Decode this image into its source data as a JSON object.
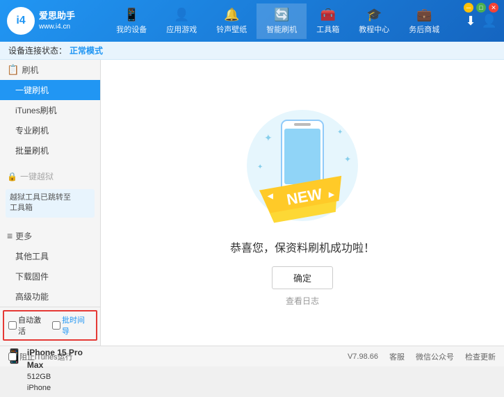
{
  "app": {
    "logo_line1": "爱思助手",
    "logo_line2": "www.i4.cn",
    "logo_letter": "i4"
  },
  "nav": {
    "items": [
      {
        "id": "my-device",
        "icon": "📱",
        "label": "我的设备"
      },
      {
        "id": "app-games",
        "icon": "👤",
        "label": "应用游戏"
      },
      {
        "id": "ringtones",
        "icon": "🔔",
        "label": "铃声壁纸"
      },
      {
        "id": "smart-flash",
        "icon": "🔄",
        "label": "智能刷机",
        "active": true
      },
      {
        "id": "toolbox",
        "icon": "🧰",
        "label": "工具箱"
      },
      {
        "id": "tutorial",
        "icon": "🎓",
        "label": "教程中心"
      },
      {
        "id": "service",
        "icon": "💼",
        "label": "务后商城"
      }
    ],
    "right_download": "⬇",
    "right_user": "👤"
  },
  "status_bar": {
    "prefix": "设备连接状态：",
    "status": "正常模式"
  },
  "sidebar": {
    "flash_section": "刷机",
    "items": [
      {
        "id": "one-key-flash",
        "label": "一键刷机",
        "active": true
      },
      {
        "id": "itunes-flash",
        "label": "iTunes刷机"
      },
      {
        "id": "pro-flash",
        "label": "专业刷机"
      },
      {
        "id": "batch-flash",
        "label": "批量刷机"
      }
    ],
    "one_key_restore_label": "一键越狱",
    "restore_disabled": true,
    "notice": "越狱工具已跳转至\n工具箱",
    "more_section": "更多",
    "more_items": [
      {
        "id": "other-tools",
        "label": "其他工具"
      },
      {
        "id": "download-firm",
        "label": "下载固件"
      },
      {
        "id": "advanced",
        "label": "高级功能"
      }
    ],
    "auto_activate": "自动激活",
    "auto_import": "批时间导",
    "device_name": "iPhone 15 Pro Max",
    "device_storage": "512GB",
    "device_type": "iPhone"
  },
  "content": {
    "success_message": "恭喜您，保资料刷机成功啦！",
    "confirm_btn": "确定",
    "view_log": "查看日志"
  },
  "bottom_bar": {
    "stop_itunes": "阻止iTunes运行",
    "version": "V7.98.66",
    "customer_service": "客服",
    "wechat": "微信公众号",
    "check_update": "检查更新"
  },
  "colors": {
    "brand_blue": "#2196f3",
    "dark_blue": "#1565c0",
    "active_sidebar": "#2196f3",
    "red_border": "#e53935"
  }
}
